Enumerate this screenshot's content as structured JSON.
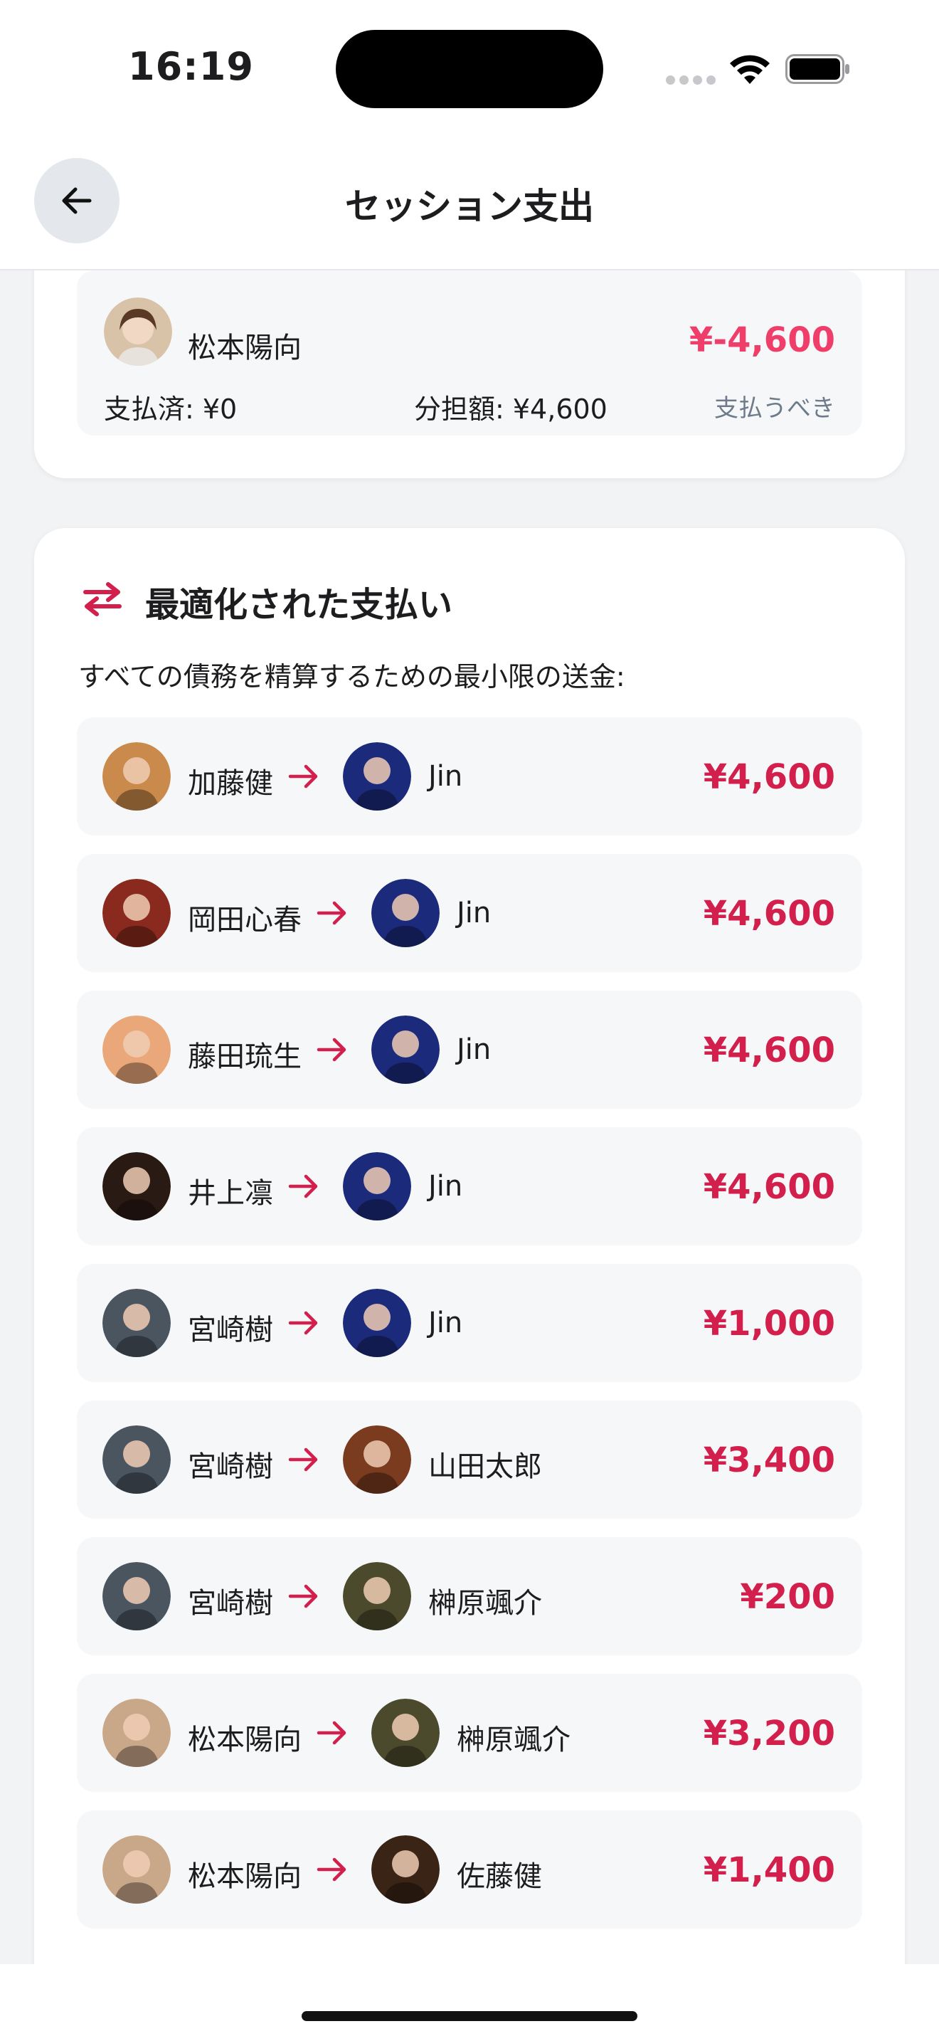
{
  "status_bar": {
    "time": "16:19"
  },
  "nav": {
    "back_icon": "arrow-left-icon",
    "title": "セッション支出"
  },
  "member": {
    "name": "松本陽向",
    "balance": "¥-4,600",
    "paid": "支払済: ¥0",
    "share": "分担額: ¥4,600",
    "status": "支払うべき"
  },
  "settlement": {
    "icon": "swap-arrows-icon",
    "title": "最適化された支払い",
    "description": "すべての債務を精算するための最小限の送金:",
    "payments": [
      {
        "from": "加藤健",
        "to": "Jin",
        "amount": "¥4,600",
        "from_color": "#c98a4b",
        "to_color": "#1b2a7a"
      },
      {
        "from": "岡田心春",
        "to": "Jin",
        "amount": "¥4,600",
        "from_color": "#8a2a1e",
        "to_color": "#1b2a7a"
      },
      {
        "from": "藤田琉生",
        "to": "Jin",
        "amount": "¥4,600",
        "from_color": "#e9a77a",
        "to_color": "#1b2a7a"
      },
      {
        "from": "井上凛",
        "to": "Jin",
        "amount": "¥4,600",
        "from_color": "#2a1a14",
        "to_color": "#1b2a7a"
      },
      {
        "from": "宮崎樹",
        "to": "Jin",
        "amount": "¥1,000",
        "from_color": "#4a5560",
        "to_color": "#1b2a7a"
      },
      {
        "from": "宮崎樹",
        "to": "山田太郎",
        "amount": "¥3,400",
        "from_color": "#4a5560",
        "to_color": "#7a3b1f"
      },
      {
        "from": "宮崎樹",
        "to": "榊原颯介",
        "amount": "¥200",
        "from_color": "#4a5560",
        "to_color": "#4b4a2c"
      },
      {
        "from": "松本陽向",
        "to": "榊原颯介",
        "amount": "¥3,200",
        "from_color": "#c9a88a",
        "to_color": "#4b4a2c"
      },
      {
        "from": "松本陽向",
        "to": "佐藤健",
        "amount": "¥1,400",
        "from_color": "#c9a88a",
        "to_color": "#3a2416"
      }
    ]
  },
  "colors": {
    "accent": "#d21f4b",
    "negative_balance": "#ef3e6a",
    "muted": "#6e7b8b"
  }
}
